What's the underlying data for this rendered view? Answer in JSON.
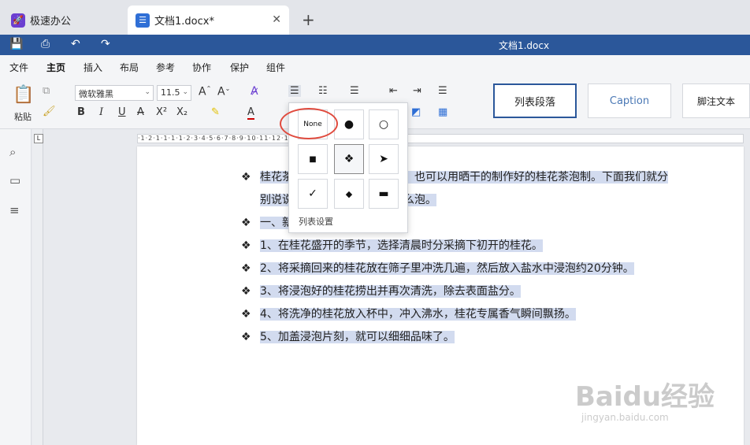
{
  "tabs": {
    "home": {
      "label": "极速办公"
    },
    "doc": {
      "label": "文档1.docx*"
    }
  },
  "titlebar": {
    "title": "文档1.docx"
  },
  "menu": [
    "文件",
    "主页",
    "插入",
    "布局",
    "参考",
    "协作",
    "保护",
    "组件"
  ],
  "ribbon": {
    "paste_label": "粘贴",
    "font_name": "微软雅黑",
    "font_size": "11.5",
    "bold": "B",
    "italic": "I",
    "underline": "U",
    "strike": "A",
    "superscript": "X²",
    "subscript": "X₂",
    "styles": [
      "列表段落",
      "Caption",
      "脚注文本"
    ]
  },
  "bullet_panel": {
    "cells": [
      "None",
      "●",
      "○",
      "■",
      "❖",
      "➤",
      "✓",
      "◆",
      "▬"
    ],
    "footer": "列表设置"
  },
  "document": {
    "lines": [
      "桂花茶可以用新鲜的桂花泡制，也可以用晒干的制作好的桂花茶泡制。下面我们就分",
      "别说说新鲜桂花和干桂花茶怎么泡。",
      "一、新鲜桂花茶的泡法",
      "1、在桂花盛开的季节，选择清晨时分采摘下初开的桂花。",
      "2、将采摘回来的桂花放在筛子里冲洗几遍，然后放入盐水中浸泡约20分钟。",
      "3、将浸泡好的桂花捞出并再次清洗，除去表面盐分。",
      "4、将洗净的桂花放入杯中，冲入沸水，桂花专属香气瞬间飘扬。",
      "5、加盖浸泡片刻，就可以细细品味了。"
    ]
  },
  "watermark": {
    "main": "Baidu经验",
    "sub": "jingyan.baidu.com"
  },
  "colors": {
    "accent": "#2b579a",
    "highlight": "#d2dbef",
    "annotation": "#e04a3d"
  }
}
